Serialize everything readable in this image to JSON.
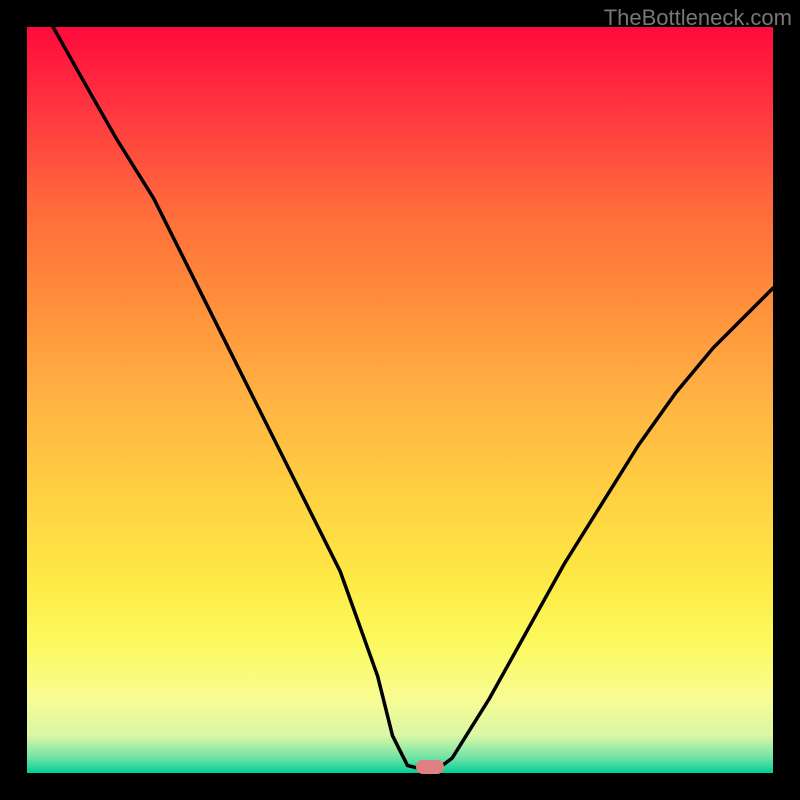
{
  "watermark": "TheBottleneck.com",
  "chart_data": {
    "type": "line",
    "title": "",
    "xlabel": "",
    "ylabel": "",
    "xlim": [
      0,
      100
    ],
    "ylim": [
      0,
      100
    ],
    "series": [
      {
        "name": "bottleneck-curve",
        "x": [
          3.5,
          8,
          12,
          17,
          22,
          27,
          32,
          37,
          42,
          47,
          49,
          51,
          53,
          55,
          57,
          62,
          67,
          72,
          77,
          82,
          87,
          92,
          97,
          100
        ],
        "y": [
          100,
          92,
          85,
          77,
          67,
          57,
          47,
          37,
          27,
          13,
          5,
          1,
          0.5,
          0.5,
          2,
          10,
          19,
          28,
          36,
          44,
          51,
          57,
          62,
          65
        ]
      }
    ],
    "marker": {
      "x": 54,
      "y": 0.8
    },
    "gradient_zones": [
      {
        "pct": 0,
        "color": "#ff0a3b"
      },
      {
        "pct": 50,
        "color": "#ffb343"
      },
      {
        "pct": 82,
        "color": "#fcf95a"
      },
      {
        "pct": 100,
        "color": "#00cf98"
      }
    ]
  }
}
